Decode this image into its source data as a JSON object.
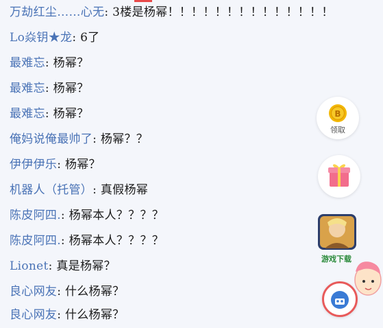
{
  "chat": {
    "messages": [
      {
        "user": "万劫红尘……心无",
        "text": "3楼是杨幂！！！！！！！！！！！！！！"
      },
      {
        "user": "Lo焱钥★龙",
        "text": "6了"
      },
      {
        "user": "最难忘",
        "text": "杨幂？"
      },
      {
        "user": "最难忘",
        "text": "杨幂？"
      },
      {
        "user": "最难忘",
        "text": "杨幂？"
      },
      {
        "user": "俺妈说俺最帅了",
        "text": "杨幂？？"
      },
      {
        "user": "伊伊伊乐",
        "text": "杨幂？"
      },
      {
        "user": "机器人（托管）",
        "text": "真假杨幂"
      },
      {
        "user": "陈皮阿四.",
        "text": "杨幂本人？？？？"
      },
      {
        "user": "陈皮阿四.",
        "text": "杨幂本人？？？？"
      },
      {
        "user": "Lionet",
        "text": "真是杨幂？"
      },
      {
        "user": "良心网友",
        "text": "什么杨幂？"
      },
      {
        "user": "良心网友",
        "text": "什么杨幂？"
      }
    ],
    "separator": ": "
  },
  "side": {
    "claim_label": "领取",
    "game_label": "游戏下载"
  },
  "colors": {
    "username": "#4a73b6",
    "message": "#1c1c1c",
    "coin": "#f2b705",
    "gift": "#f26d8c"
  }
}
